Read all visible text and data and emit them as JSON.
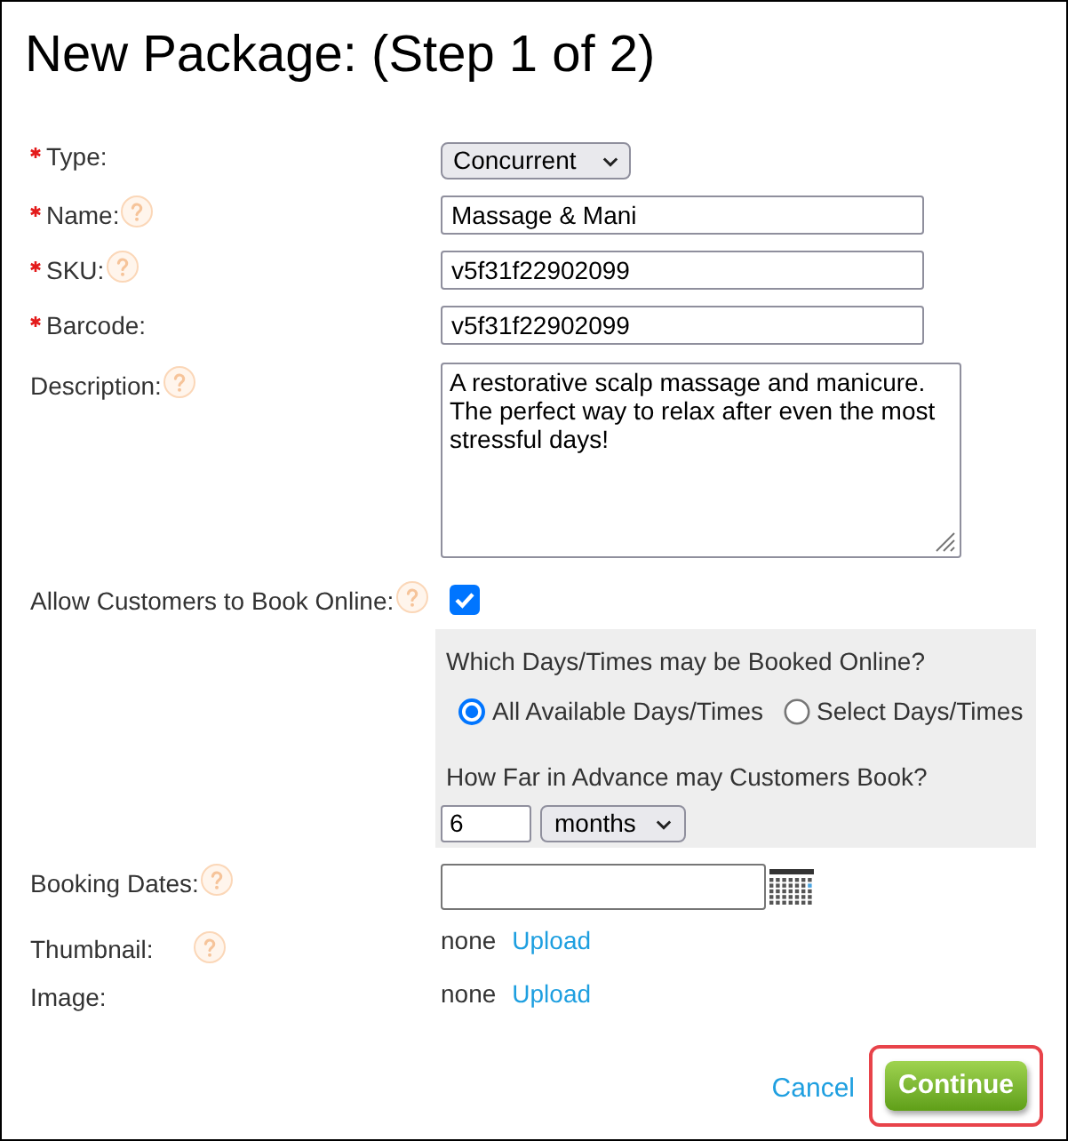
{
  "title": "New Package: (Step 1 of 2)",
  "fields": [
    {
      "kind": "select",
      "label": "Type:",
      "required": true,
      "help": false,
      "value": "Concurrent"
    },
    {
      "kind": "text",
      "label": "Name:",
      "required": true,
      "help": true,
      "value": "Massage & Mani"
    },
    {
      "kind": "text",
      "label": "SKU:",
      "required": true,
      "help": true,
      "value": "v5f31f22902099"
    },
    {
      "kind": "text",
      "label": "Barcode:",
      "required": true,
      "help": false,
      "value": "v5f31f22902099"
    },
    {
      "kind": "textarea",
      "label": "Description:",
      "required": false,
      "help": true,
      "value": "A restorative scalp massage and manicure. The perfect way to relax after even the most stressful days!"
    },
    {
      "kind": "checkbox",
      "label": "Allow Customers to Book Online:",
      "required": false,
      "help": true,
      "checked": true
    }
  ],
  "online_booking": {
    "question": "Which Days/Times may be Booked Online?",
    "options": [
      {
        "label": "All Available Days/Times",
        "selected": true
      },
      {
        "label": "Select Days/Times",
        "selected": false
      }
    ],
    "advance_label": "How Far in Advance may Customers Book?",
    "advance_value": "6",
    "advance_unit": "months"
  },
  "more_fields": [
    {
      "kind": "date",
      "label": "Booking Dates:",
      "help": true
    },
    {
      "kind": "upload",
      "label": "Thumbnail:",
      "help": true,
      "status": "none",
      "link": "Upload"
    },
    {
      "kind": "upload",
      "label": "Image:",
      "help": false,
      "status": "none",
      "link": "Upload"
    }
  ],
  "actions": {
    "cancel": "Cancel",
    "continue": "Continue",
    "highlighted": true
  }
}
